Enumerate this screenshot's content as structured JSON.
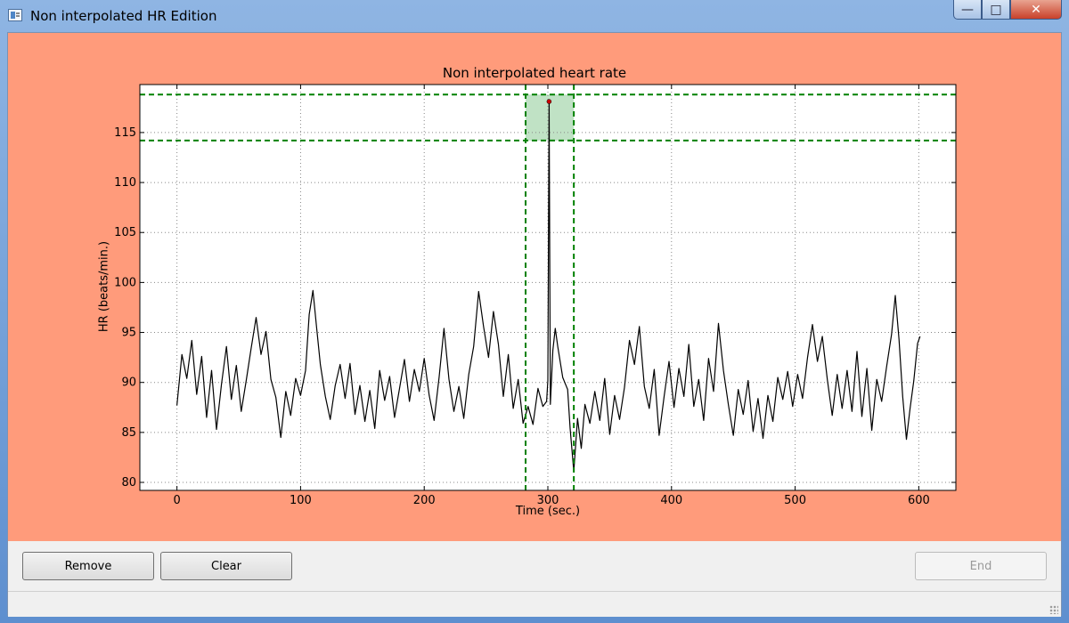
{
  "window": {
    "title": "Non interpolated HR Edition",
    "controls": [
      "minimize",
      "maximize",
      "close"
    ],
    "figure_background": "#ff9b7b"
  },
  "buttons": {
    "remove": "Remove",
    "clear": "Clear",
    "end": "End",
    "end_enabled": false
  },
  "chart_data": {
    "type": "line",
    "title": "Non interpolated heart rate",
    "xlabel": "Time (sec.)",
    "ylabel": "HR (beats/min.)",
    "xlim": [
      -30,
      630
    ],
    "ylim": [
      79.2,
      119.8
    ],
    "xticks": [
      0,
      100,
      200,
      300,
      400,
      500,
      600
    ],
    "yticks": [
      80,
      85,
      90,
      95,
      100,
      105,
      110,
      115
    ],
    "grid": true,
    "line_color": "#000000",
    "series": [
      {
        "values": [
          [
            0,
            87.7
          ],
          [
            4,
            92.8
          ],
          [
            8,
            90.4
          ],
          [
            12,
            94.2
          ],
          [
            16,
            88.8
          ],
          [
            20,
            92.6
          ],
          [
            24,
            86.5
          ],
          [
            28,
            91.2
          ],
          [
            32,
            85.3
          ],
          [
            36,
            89.8
          ],
          [
            40,
            93.6
          ],
          [
            44,
            88.3
          ],
          [
            48,
            91.7
          ],
          [
            52,
            87.1
          ],
          [
            56,
            90.2
          ],
          [
            60,
            93.4
          ],
          [
            64,
            96.5
          ],
          [
            68,
            92.8
          ],
          [
            72,
            95.1
          ],
          [
            76,
            90.3
          ],
          [
            80,
            88.5
          ],
          [
            84,
            84.5
          ],
          [
            88,
            89.1
          ],
          [
            92,
            86.7
          ],
          [
            96,
            90.4
          ],
          [
            100,
            88.7
          ],
          [
            104,
            91.2
          ],
          [
            107,
            96.8
          ],
          [
            110,
            99.2
          ],
          [
            113,
            95.4
          ],
          [
            116,
            91.8
          ],
          [
            120,
            88.6
          ],
          [
            124,
            86.3
          ],
          [
            128,
            89.7
          ],
          [
            132,
            91.8
          ],
          [
            136,
            88.4
          ],
          [
            140,
            91.9
          ],
          [
            144,
            86.8
          ],
          [
            148,
            89.7
          ],
          [
            152,
            86.1
          ],
          [
            156,
            89.2
          ],
          [
            160,
            85.4
          ],
          [
            164,
            91.2
          ],
          [
            168,
            88.2
          ],
          [
            172,
            90.6
          ],
          [
            176,
            86.5
          ],
          [
            180,
            89.4
          ],
          [
            184,
            92.3
          ],
          [
            188,
            88.1
          ],
          [
            192,
            91.3
          ],
          [
            196,
            89.1
          ],
          [
            200,
            92.4
          ],
          [
            204,
            88.7
          ],
          [
            208,
            86.2
          ],
          [
            212,
            90.5
          ],
          [
            216,
            95.4
          ],
          [
            220,
            90.3
          ],
          [
            224,
            87.1
          ],
          [
            228,
            89.6
          ],
          [
            232,
            86.4
          ],
          [
            236,
            90.8
          ],
          [
            240,
            93.6
          ],
          [
            244,
            99.1
          ],
          [
            248,
            95.6
          ],
          [
            252,
            92.5
          ],
          [
            256,
            97.1
          ],
          [
            260,
            93.8
          ],
          [
            264,
            88.6
          ],
          [
            268,
            92.8
          ],
          [
            272,
            87.4
          ],
          [
            276,
            90.3
          ],
          [
            280,
            85.9
          ],
          [
            284,
            87.6
          ],
          [
            288,
            85.8
          ],
          [
            292,
            89.4
          ],
          [
            296,
            87.6
          ],
          [
            299,
            88.1
          ],
          [
            300,
            90.2
          ],
          [
            301,
            118.1
          ],
          [
            302,
            87.8
          ],
          [
            304,
            93.2
          ],
          [
            306,
            95.4
          ],
          [
            308,
            93.6
          ],
          [
            312,
            90.5
          ],
          [
            316,
            89.3
          ],
          [
            318,
            85.4
          ],
          [
            321,
            81.1
          ],
          [
            324,
            86.4
          ],
          [
            327,
            83.4
          ],
          [
            330,
            87.8
          ],
          [
            334,
            85.9
          ],
          [
            338,
            89.1
          ],
          [
            342,
            86.2
          ],
          [
            346,
            90.4
          ],
          [
            350,
            84.8
          ],
          [
            354,
            88.7
          ],
          [
            358,
            86.3
          ],
          [
            362,
            89.5
          ],
          [
            366,
            94.2
          ],
          [
            370,
            91.8
          ],
          [
            374,
            95.6
          ],
          [
            378,
            89.6
          ],
          [
            382,
            87.4
          ],
          [
            386,
            91.3
          ],
          [
            390,
            84.7
          ],
          [
            394,
            88.6
          ],
          [
            398,
            92.1
          ],
          [
            402,
            87.5
          ],
          [
            406,
            91.4
          ],
          [
            410,
            88.6
          ],
          [
            414,
            93.8
          ],
          [
            418,
            87.6
          ],
          [
            422,
            90.3
          ],
          [
            426,
            86.2
          ],
          [
            430,
            92.4
          ],
          [
            434,
            89.1
          ],
          [
            438,
            95.9
          ],
          [
            442,
            91.2
          ],
          [
            446,
            87.8
          ],
          [
            450,
            84.7
          ],
          [
            454,
            89.3
          ],
          [
            458,
            86.8
          ],
          [
            462,
            90.2
          ],
          [
            466,
            85.1
          ],
          [
            470,
            88.4
          ],
          [
            474,
            84.4
          ],
          [
            478,
            88.7
          ],
          [
            482,
            86.1
          ],
          [
            486,
            90.5
          ],
          [
            490,
            88.3
          ],
          [
            494,
            91.1
          ],
          [
            498,
            87.6
          ],
          [
            502,
            90.8
          ],
          [
            506,
            88.4
          ],
          [
            510,
            92.5
          ],
          [
            514,
            95.8
          ],
          [
            518,
            92.1
          ],
          [
            522,
            94.6
          ],
          [
            526,
            90.3
          ],
          [
            530,
            86.7
          ],
          [
            534,
            90.8
          ],
          [
            538,
            87.4
          ],
          [
            542,
            91.2
          ],
          [
            546,
            87.1
          ],
          [
            550,
            93.1
          ],
          [
            554,
            86.6
          ],
          [
            558,
            91.4
          ],
          [
            562,
            85.2
          ],
          [
            566,
            90.3
          ],
          [
            570,
            88.1
          ],
          [
            574,
            91.6
          ],
          [
            578,
            94.8
          ],
          [
            581,
            98.7
          ],
          [
            584,
            94.3
          ],
          [
            587,
            88.6
          ],
          [
            590,
            84.3
          ],
          [
            593,
            87.4
          ],
          [
            596,
            90.2
          ],
          [
            599,
            93.9
          ],
          [
            601,
            94.6
          ]
        ]
      }
    ],
    "selection": {
      "color": "#008000",
      "fill": "#2e9e3e",
      "x_range": [
        282,
        321
      ],
      "y_range": [
        114.2,
        118.8
      ]
    },
    "highlighted_point": {
      "x": 301,
      "y": 118.1,
      "color": "#cc0000"
    }
  }
}
